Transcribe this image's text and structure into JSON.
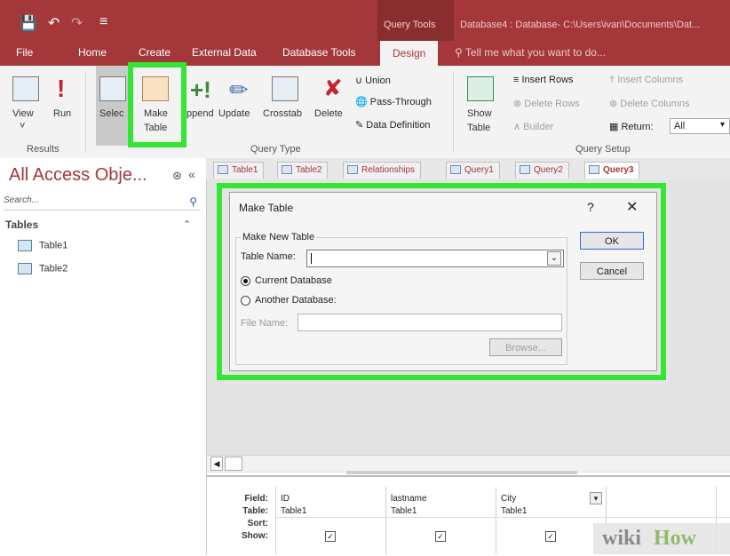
{
  "title_bar": {
    "context_label": "Query Tools",
    "document_title": "Database4 : Database- C:\\Users\\ivan\\Documents\\Dat..."
  },
  "tabs": [
    "File",
    "Home",
    "Create",
    "External Data",
    "Database Tools",
    "Design"
  ],
  "tell_me": "Tell me what you want to do...",
  "ribbon": {
    "results": {
      "view": "View",
      "run": "Run",
      "group": "Results"
    },
    "query_type": {
      "select": "Selec",
      "make_table_1": "Make",
      "make_table_2": "Table",
      "append": "ppend",
      "update": "Update",
      "crosstab": "Crosstab",
      "delete": "Delete",
      "union": "Union",
      "pass_through": "Pass-Through",
      "data_definition": "Data Definition",
      "group": "Query Type"
    },
    "query_setup": {
      "show_table_1": "Show",
      "show_table_2": "Table",
      "insert_rows": "Insert Rows",
      "delete_rows": "Delete Rows",
      "builder": "Builder",
      "insert_columns": "Insert Columns",
      "delete_columns": "Delete Columns",
      "return_label": "Return:",
      "return_value": "All",
      "group": "Query Setup"
    }
  },
  "nav": {
    "title": "All Access Obje...",
    "search": "Search...",
    "section": "Tables",
    "items": [
      "Table1",
      "Table2"
    ]
  },
  "doc_tabs": [
    "Table1",
    "Table2",
    "Relationships",
    "Query1",
    "Query2",
    "Query3"
  ],
  "dialog": {
    "title": "Make Table",
    "help": "?",
    "close": "✕",
    "group_label": "Make New Table",
    "table_name_label": "Table Name:",
    "table_name_value": "",
    "current_db": "Current Database",
    "another_db": "Another Database:",
    "file_name_label": "File Name:",
    "browse": "Browse...",
    "ok": "OK",
    "cancel": "Cancel"
  },
  "grid": {
    "row_headers": [
      "Field:",
      "Table:",
      "Sort:",
      "Show:"
    ],
    "columns": [
      {
        "field": "ID",
        "table": "Table1",
        "show": true
      },
      {
        "field": "lastname",
        "table": "Table1",
        "show": true
      },
      {
        "field": "City",
        "table": "Table1",
        "show": true
      }
    ]
  },
  "watermark": {
    "part1": "wiki",
    "part2": "How"
  },
  "colors": {
    "accent": "#a4373a",
    "highlight": "#33e633"
  }
}
